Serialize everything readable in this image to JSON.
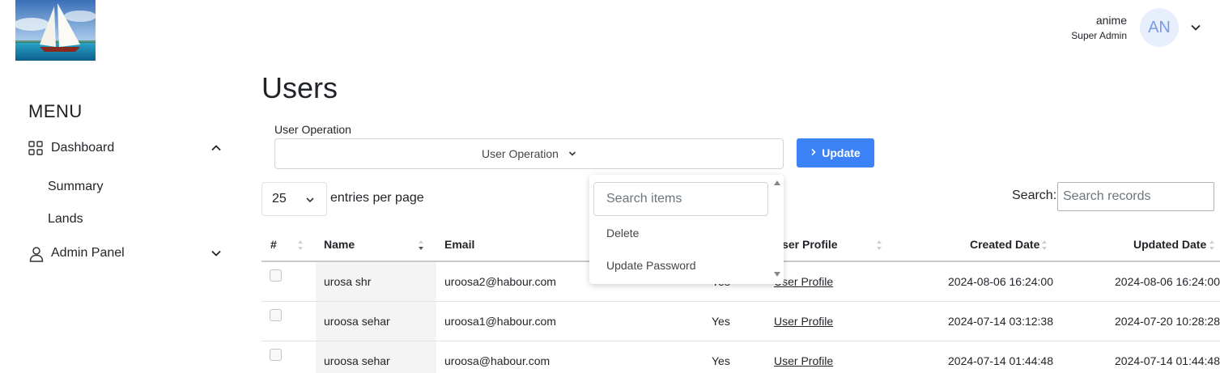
{
  "header": {
    "user_name": "anime",
    "user_role": "Super Admin",
    "avatar_initials": "AN"
  },
  "sidebar": {
    "menu_title": "MENU",
    "items": [
      {
        "label": "Dashboard",
        "icon": "grid-icon",
        "expanded": true
      },
      {
        "label": "Summary"
      },
      {
        "label": "Lands"
      },
      {
        "label": "Admin Panel",
        "icon": "user-icon",
        "expanded": false
      }
    ]
  },
  "main": {
    "title": "Users",
    "operation": {
      "label": "User Operation",
      "selected": "User Operation",
      "button_label": "Update",
      "options": [
        "Delete",
        "Update Password"
      ],
      "search_placeholder": "Search items"
    },
    "table_controls": {
      "entries_value": "25",
      "entries_label": "entries per page",
      "search_label": "Search:",
      "search_placeholder": "Search records"
    },
    "columns": [
      "#",
      "Name",
      "Email",
      "User Profile",
      "Created Date",
      "Updated Date"
    ],
    "rows": [
      {
        "name": "urosa shr",
        "email": "uroosa2@habour.com",
        "status": "Yes",
        "profile": "User Profile",
        "created": "2024-08-06 16:24:00",
        "updated": "2024-08-06 16:24:00"
      },
      {
        "name": "uroosa sehar",
        "email": "uroosa1@habour.com",
        "status": "Yes",
        "profile": "User Profile",
        "created": "2024-07-14 03:12:38",
        "updated": "2024-07-20 10:28:28"
      },
      {
        "name": "uroosa sehar",
        "email": "uroosa@habour.com",
        "status": "Yes",
        "profile": "User Profile",
        "created": "2024-07-14 01:44:48",
        "updated": "2024-07-14 01:44:48"
      }
    ]
  },
  "colors": {
    "accent": "#3b82f6",
    "avatar_bg": "#e7eefc",
    "avatar_text": "#7a9be6"
  }
}
